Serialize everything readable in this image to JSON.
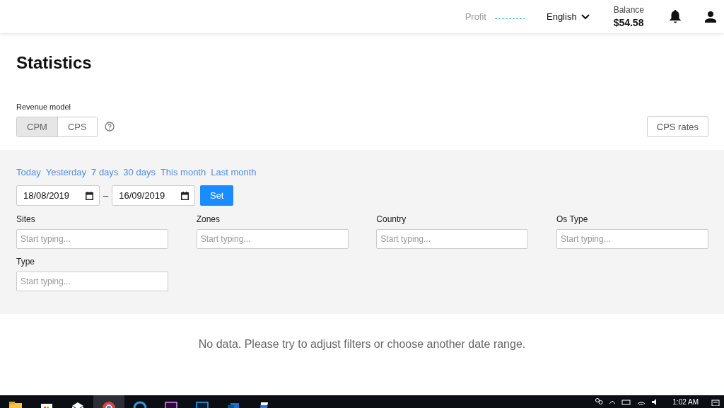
{
  "header": {
    "profit_label": "Profit",
    "language": "English",
    "balance_label": "Balance",
    "balance": "$54.58"
  },
  "page_title": "Statistics",
  "revenue_model": {
    "label": "Revenue model",
    "options": [
      {
        "label": "CPM",
        "selected": true
      },
      {
        "label": "CPS",
        "selected": false
      }
    ]
  },
  "rates_button": "CPS rates",
  "quick_ranges": [
    "Today",
    "Yesterday",
    "7 days",
    "30 days",
    "This month",
    "Last month"
  ],
  "date_from": "18/08/2019",
  "date_separator": "–",
  "date_to": "16/09/2019",
  "set_button": "Set",
  "filters": [
    {
      "label": "Sites",
      "placeholder": "Start typing..."
    },
    {
      "label": "Zones",
      "placeholder": "Start typing..."
    },
    {
      "label": "Country",
      "placeholder": "Start typing..."
    },
    {
      "label": "Os Type",
      "placeholder": "Start typing..."
    },
    {
      "label": "Type",
      "placeholder": "Start typing..."
    }
  ],
  "empty_message": "No data. Please try to adjust filters or choose another date range.",
  "taskbar": {
    "apps": [
      {
        "kind": "folder",
        "selected": false
      },
      {
        "kind": "store",
        "selected": false
      },
      {
        "kind": "mail",
        "selected": false
      },
      {
        "kind": "chrome",
        "selected": true
      },
      {
        "kind": "edge",
        "selected": false
      },
      {
        "kind": "premiere",
        "selected": false
      },
      {
        "kind": "photoshop",
        "selected": false
      },
      {
        "kind": "outlook",
        "selected": false
      },
      {
        "kind": "document",
        "selected": false
      }
    ],
    "clock": "1:02 AM"
  }
}
